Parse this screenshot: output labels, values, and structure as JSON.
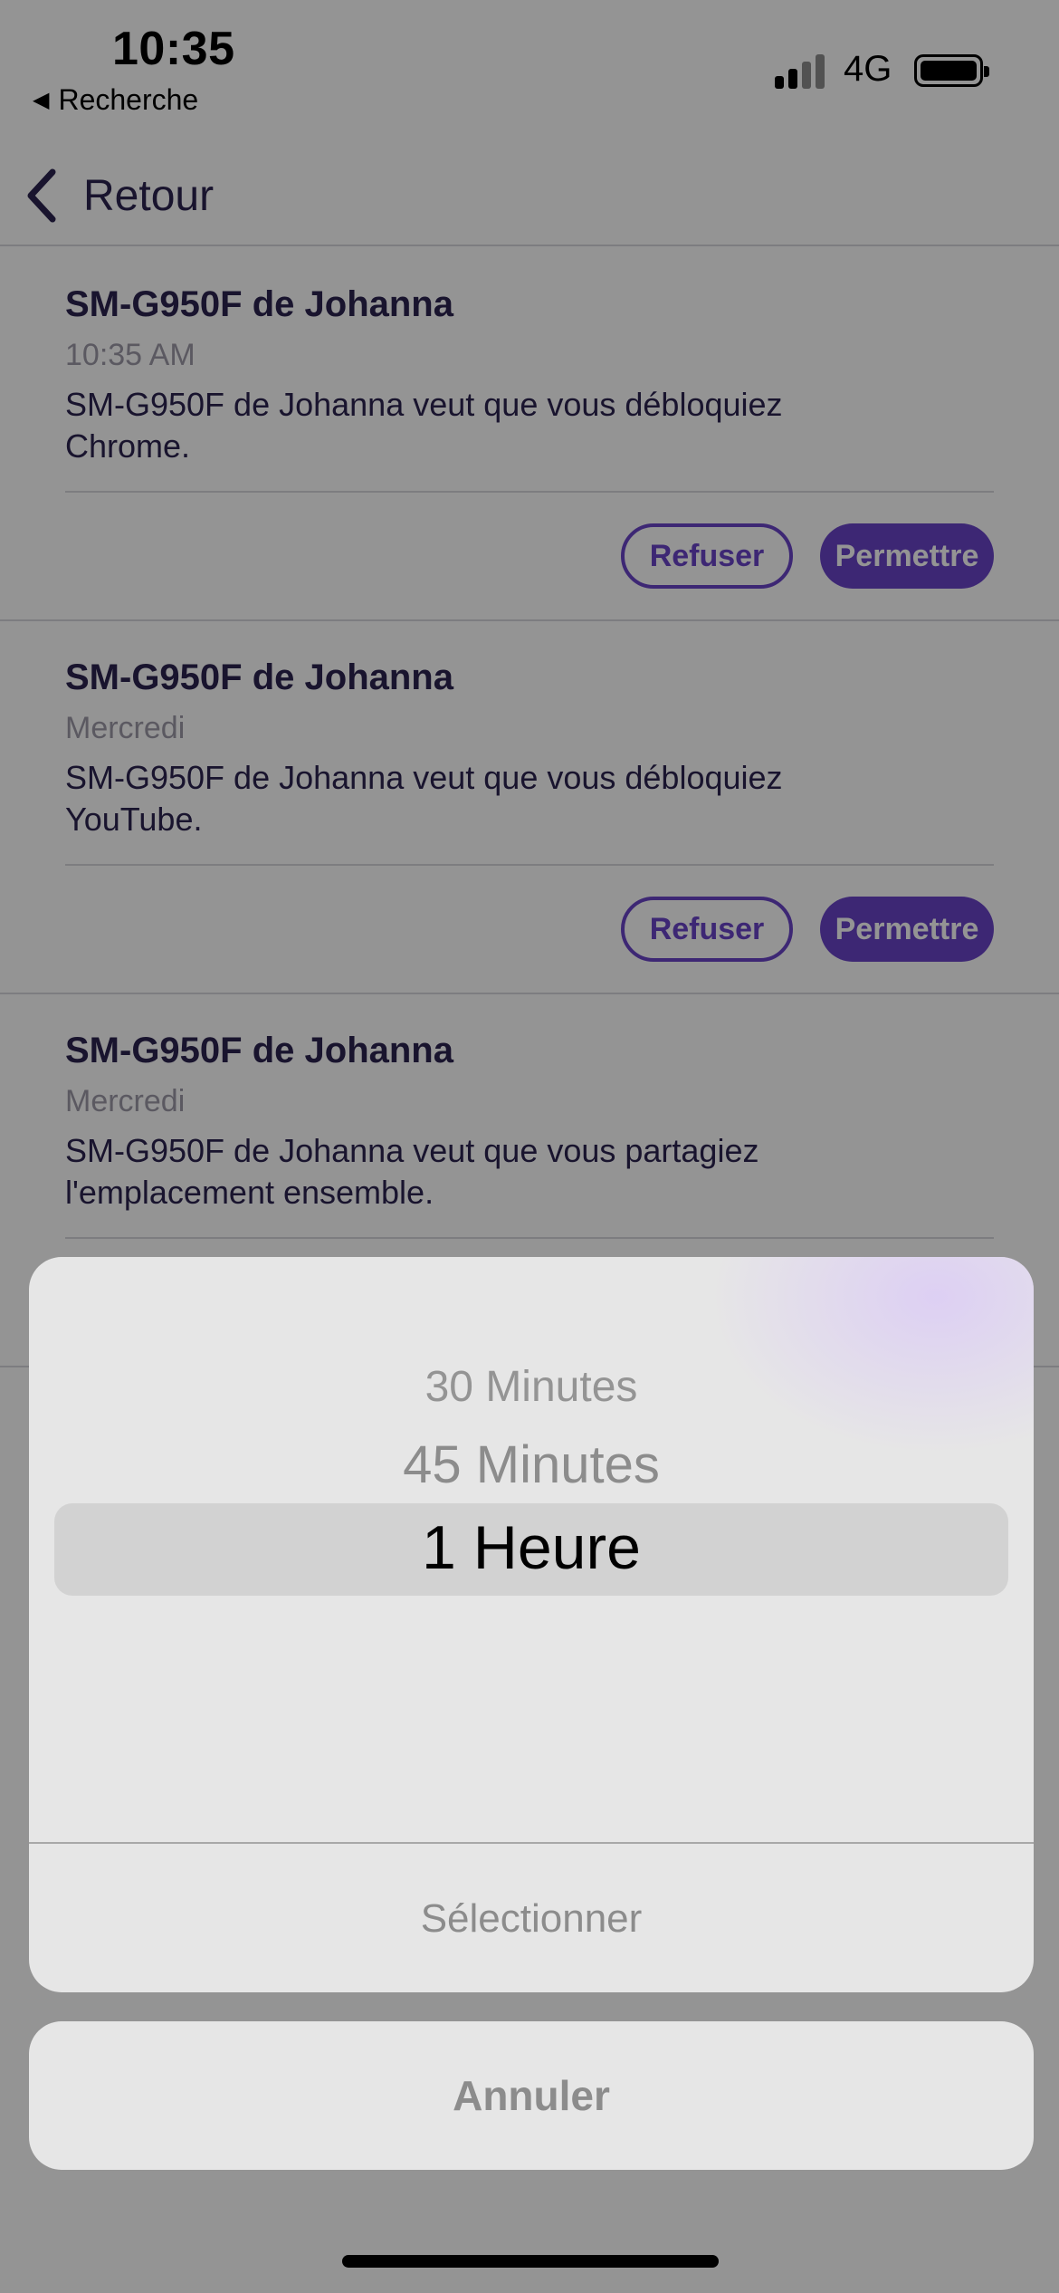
{
  "status": {
    "time": "10:35",
    "back_app": "Recherche",
    "network": "4G"
  },
  "nav": {
    "back_label": "Retour"
  },
  "notifications": [
    {
      "title": "SM-G950F de Johanna",
      "date": "10:35 AM",
      "message": "SM-G950F de Johanna veut que vous débloquiez Chrome.",
      "refuse": "Refuser",
      "allow": "Permettre"
    },
    {
      "title": "SM-G950F de Johanna",
      "date": "Mercredi",
      "message": "SM-G950F de Johanna veut que vous débloquiez YouTube.",
      "refuse": "Refuser",
      "allow": "Permettre"
    },
    {
      "title": "SM-G950F de Johanna",
      "date": "Mercredi",
      "message": "SM-G950F de Johanna veut que vous partagiez l'emplacement ensemble."
    }
  ],
  "picker": {
    "options": [
      "30 Minutes",
      "45 Minutes",
      "1 Heure"
    ],
    "selected": "1 Heure",
    "select_label": "Sélectionner",
    "cancel_label": "Annuler"
  },
  "colors": {
    "accent": "#6a44c9",
    "text": "#2b2350",
    "overlay": "rgba(0,0,0,0.42)"
  }
}
